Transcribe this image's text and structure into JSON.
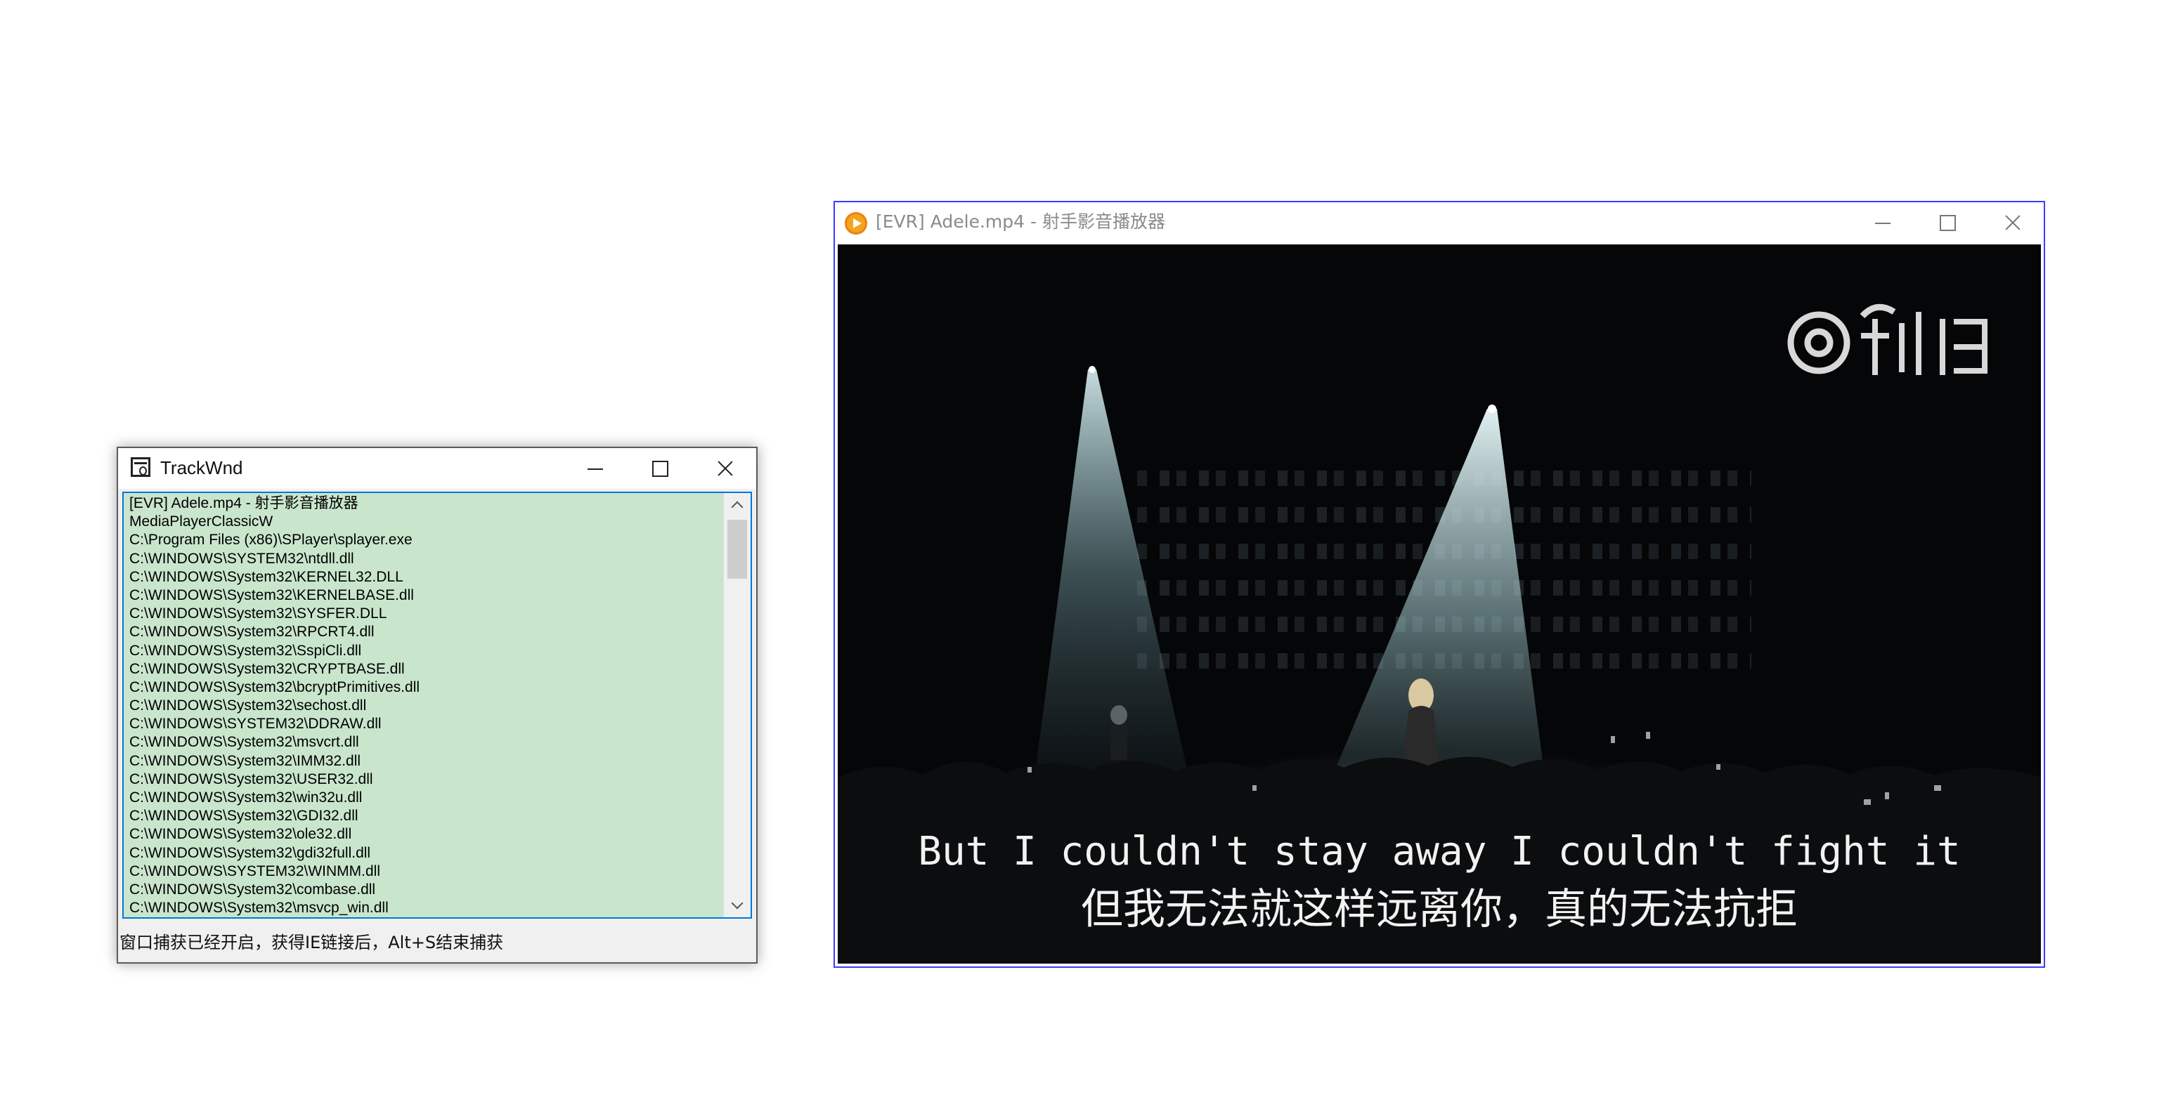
{
  "track_window": {
    "title": "TrackWnd",
    "lines": [
      "[EVR] Adele.mp4 - 射手影音播放器",
      "MediaPlayerClassicW",
      "C:\\Program Files (x86)\\SPlayer\\splayer.exe",
      "C:\\WINDOWS\\SYSTEM32\\ntdll.dll",
      "C:\\WINDOWS\\System32\\KERNEL32.DLL",
      "C:\\WINDOWS\\System32\\KERNELBASE.dll",
      "C:\\WINDOWS\\System32\\SYSFER.DLL",
      "C:\\WINDOWS\\System32\\RPCRT4.dll",
      "C:\\WINDOWS\\System32\\SspiCli.dll",
      "C:\\WINDOWS\\System32\\CRYPTBASE.dll",
      "C:\\WINDOWS\\System32\\bcryptPrimitives.dll",
      "C:\\WINDOWS\\System32\\sechost.dll",
      "C:\\WINDOWS\\SYSTEM32\\DDRAW.dll",
      "C:\\WINDOWS\\System32\\msvcrt.dll",
      "C:\\WINDOWS\\System32\\IMM32.dll",
      "C:\\WINDOWS\\System32\\USER32.dll",
      "C:\\WINDOWS\\System32\\win32u.dll",
      "C:\\WINDOWS\\System32\\GDI32.dll",
      "C:\\WINDOWS\\System32\\ole32.dll",
      "C:\\WINDOWS\\System32\\gdi32full.dll",
      "C:\\WINDOWS\\SYSTEM32\\WINMM.dll",
      "C:\\WINDOWS\\System32\\combase.dll",
      "C:\\WINDOWS\\System32\\msvcp_win.dll"
    ],
    "status": "窗口捕获已经开启，获得IE链接后，Alt+S结束捕获",
    "listbox_bg": "#c9e6cc"
  },
  "player_window": {
    "title": "[EVR] Adele.mp4 - 射手影音播放器",
    "subtitle_en": "But I couldn't stay away I couldn't fight it",
    "subtitle_zh": "但我无法就这样远离你，真的无法抗拒",
    "watermark": "秒拍",
    "icon": "splayer-play-icon",
    "accent": "#f4a31c"
  },
  "icons": {
    "minimize": "minimize-icon",
    "maximize": "maximize-icon",
    "close": "close-icon"
  }
}
